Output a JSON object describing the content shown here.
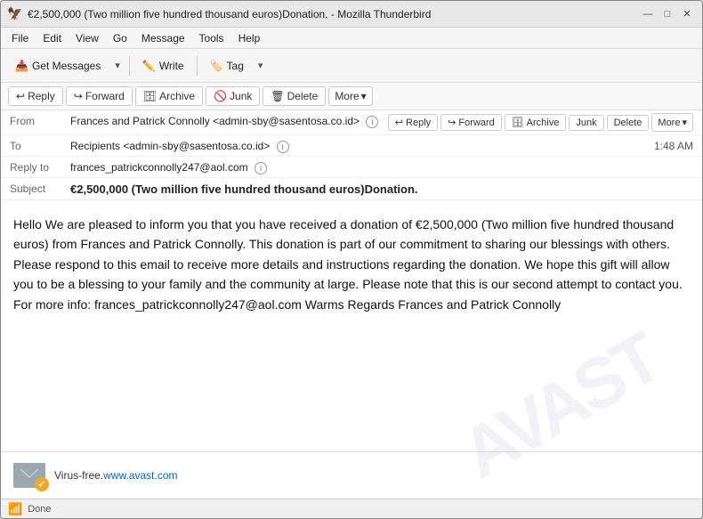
{
  "window": {
    "title": "€2,500,000 (Two million five hundred thousand euros)Donation. - Mozilla Thunderbird"
  },
  "menu": {
    "items": [
      "File",
      "Edit",
      "View",
      "Go",
      "Message",
      "Tools",
      "Help"
    ]
  },
  "toolbar": {
    "get_messages": "Get Messages",
    "write": "Write",
    "tag": "Tag"
  },
  "action_bar": {
    "reply": "Reply",
    "forward": "Forward",
    "archive": "Archive",
    "junk": "Junk",
    "delete": "Delete",
    "more": "More"
  },
  "email": {
    "from_label": "From",
    "from_value": "Frances and Patrick Connolly <admin-sby@sasentosa.co.id>",
    "to_label": "To",
    "to_value": "Recipients <admin-sby@sasentosa.co.id>",
    "reply_to_label": "Reply to",
    "reply_to_value": "frances_patrickconnolly247@aol.com",
    "subject_label": "Subject",
    "subject_value": "€2,500,000 (Two million five hundred thousand euros)Donation.",
    "time": "1:48 AM",
    "body": "Hello We are pleased to inform you that you have received a donation of €2,500,000 (Two million five hundred thousand euros) from Frances and Patrick Connolly. This donation is part of our commitment to sharing our blessings with others. Please respond to this email to receive more details and instructions regarding the donation. We hope this gift will allow you to be a blessing to your family and the community at large. Please note that this is our second attempt to contact you. For more info: frances_patrickconnolly247@aol.com Warms Regards Frances and Patrick Connolly"
  },
  "avast": {
    "text": "Virus-free.",
    "link_text": "www.avast.com",
    "link_url": "http://www.avast.com"
  },
  "status": {
    "text": "Done"
  }
}
